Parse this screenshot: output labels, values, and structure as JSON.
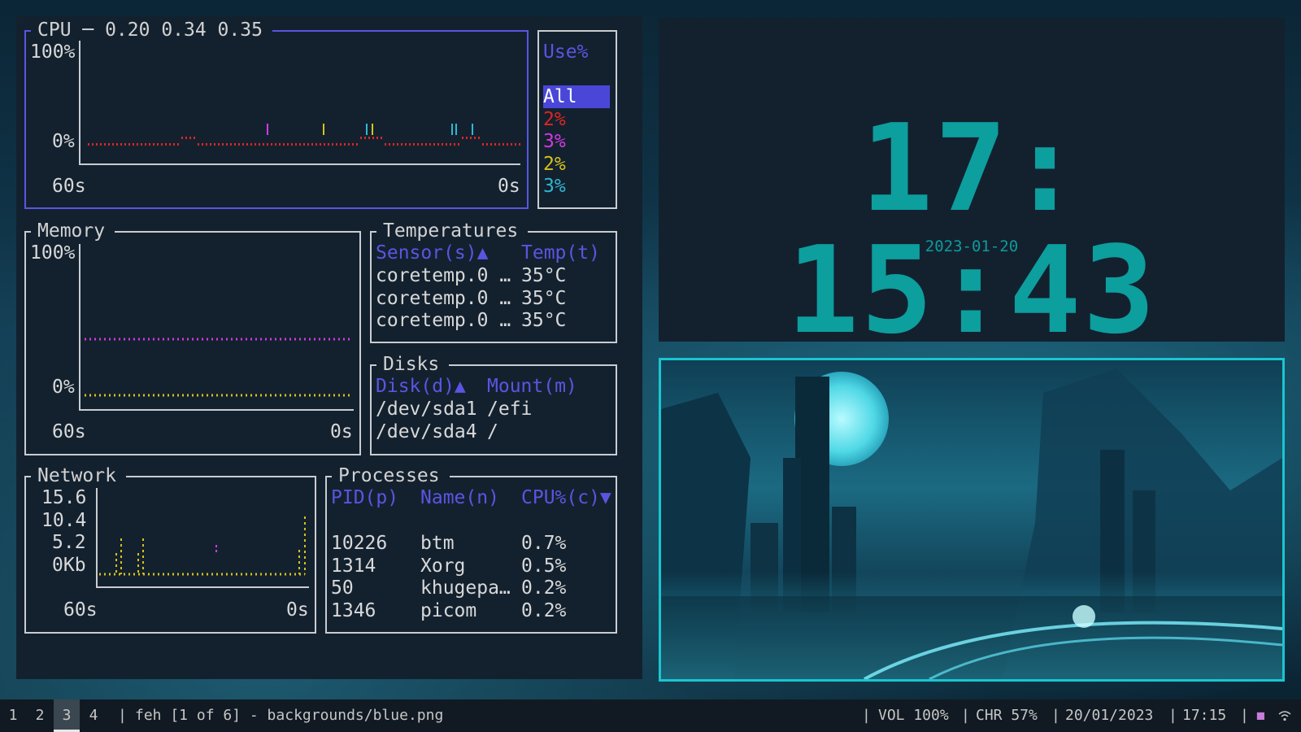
{
  "cpu": {
    "title": "CPU ─ 0.20 0.34 0.35",
    "y_top": "100%",
    "y_bottom": "0%",
    "x_left": "60s",
    "x_right": "0s",
    "legend_header": "Use%",
    "legend": [
      {
        "label": "All",
        "color": "#5a55e0",
        "selected": true
      },
      {
        "label": "2%",
        "color": "#e02424"
      },
      {
        "label": "3%",
        "color": "#d23adf"
      },
      {
        "label": "2%",
        "color": "#d6c21a"
      },
      {
        "label": "3%",
        "color": "#31b6d0"
      }
    ]
  },
  "memory": {
    "title": "Memory",
    "y_top": "100%",
    "y_bottom": "0%",
    "x_left": "60s",
    "x_right": "0s"
  },
  "temperatures": {
    "title": "Temperatures",
    "col_sensor": "Sensor(s)▲",
    "col_temp": "Temp(t)",
    "rows": [
      {
        "sensor": "coretemp.0 …",
        "temp": "35°C"
      },
      {
        "sensor": "coretemp.0 …",
        "temp": "35°C"
      },
      {
        "sensor": "coretemp.0 …",
        "temp": "35°C"
      }
    ]
  },
  "disks": {
    "title": "Disks",
    "col_disk": "Disk(d)▲",
    "col_mount": "Mount(m)",
    "rows": [
      {
        "disk": "/dev/sda1",
        "mount": "/efi"
      },
      {
        "disk": "/dev/sda4",
        "mount": "/"
      }
    ]
  },
  "network": {
    "title": "Network",
    "y_labels": [
      "15.6",
      "10.4",
      "5.2",
      "0Kb"
    ],
    "x_left": "60s",
    "x_right": "0s"
  },
  "processes": {
    "title": "Processes",
    "col_pid": "PID(p)",
    "col_name": "Name(n)",
    "col_cpu": "CPU%(c)▼",
    "rows": [
      {
        "pid": "10226",
        "name": "btm",
        "cpu": "0.7%"
      },
      {
        "pid": "1314",
        "name": "Xorg",
        "cpu": "0.5%"
      },
      {
        "pid": "50",
        "name": "khugepa…",
        "cpu": "0.2%"
      },
      {
        "pid": "1346",
        "name": "picom",
        "cpu": "0.2%"
      }
    ]
  },
  "clock": {
    "time": "17: 15:43",
    "date": "2023-01-20"
  },
  "statusbar": {
    "workspaces": [
      "1",
      "2",
      "3",
      "4"
    ],
    "active_workspace": "3",
    "window_title": "feh [1 of 6] - backgrounds/blue.png",
    "volume": "VOL 100%",
    "charge": "CHR 57%",
    "date": "20/01/2023",
    "time": "17:15"
  }
}
